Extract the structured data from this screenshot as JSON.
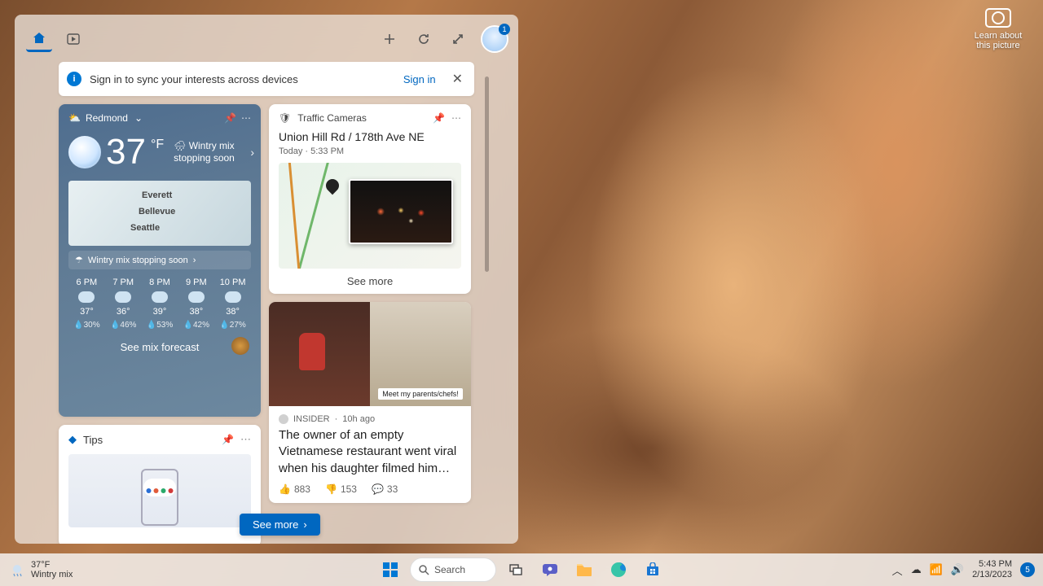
{
  "desktop": {
    "learn_label": "Learn about this picture"
  },
  "widgets": {
    "avatar_badge": "1",
    "signin": {
      "message": "Sign in to sync your interests across devices",
      "action": "Sign in"
    },
    "see_more": "See more"
  },
  "weather": {
    "location": "Redmond",
    "temp": "37",
    "unit": "°F",
    "condition_prefix": "🌧 Wintry mix",
    "condition_line2": "stopping soon",
    "map_cities": {
      "a": "Everett",
      "b": "Bellevue",
      "c": "Seattle"
    },
    "alert": "Wintry mix stopping soon",
    "hours": [
      {
        "t": "6 PM",
        "temp": "37°",
        "p": "30%"
      },
      {
        "t": "7 PM",
        "temp": "36°",
        "p": "46%"
      },
      {
        "t": "8 PM",
        "temp": "39°",
        "p": "53%"
      },
      {
        "t": "9 PM",
        "temp": "38°",
        "p": "42%"
      },
      {
        "t": "10 PM",
        "temp": "38°",
        "p": "27%"
      }
    ],
    "footer": "See mix forecast"
  },
  "tips": {
    "title": "Tips"
  },
  "traffic": {
    "title": "Traffic Cameras",
    "cam_name": "Union Hill Rd / 178th Ave NE",
    "cam_time": "Today · 5:33 PM",
    "see_more": "See more"
  },
  "news": {
    "source": "INSIDER",
    "age": "10h ago",
    "img_caption": "Meet my parents/chefs!",
    "headline": "The owner of an empty Vietnamese restaurant went viral when his daughter filmed him…",
    "likes": "883",
    "dislikes": "153",
    "comments": "33"
  },
  "taskbar": {
    "weather_temp": "37°F",
    "weather_cond": "Wintry mix",
    "search": "Search",
    "time": "5:43 PM",
    "date": "2/13/2023",
    "notif_count": "5"
  }
}
